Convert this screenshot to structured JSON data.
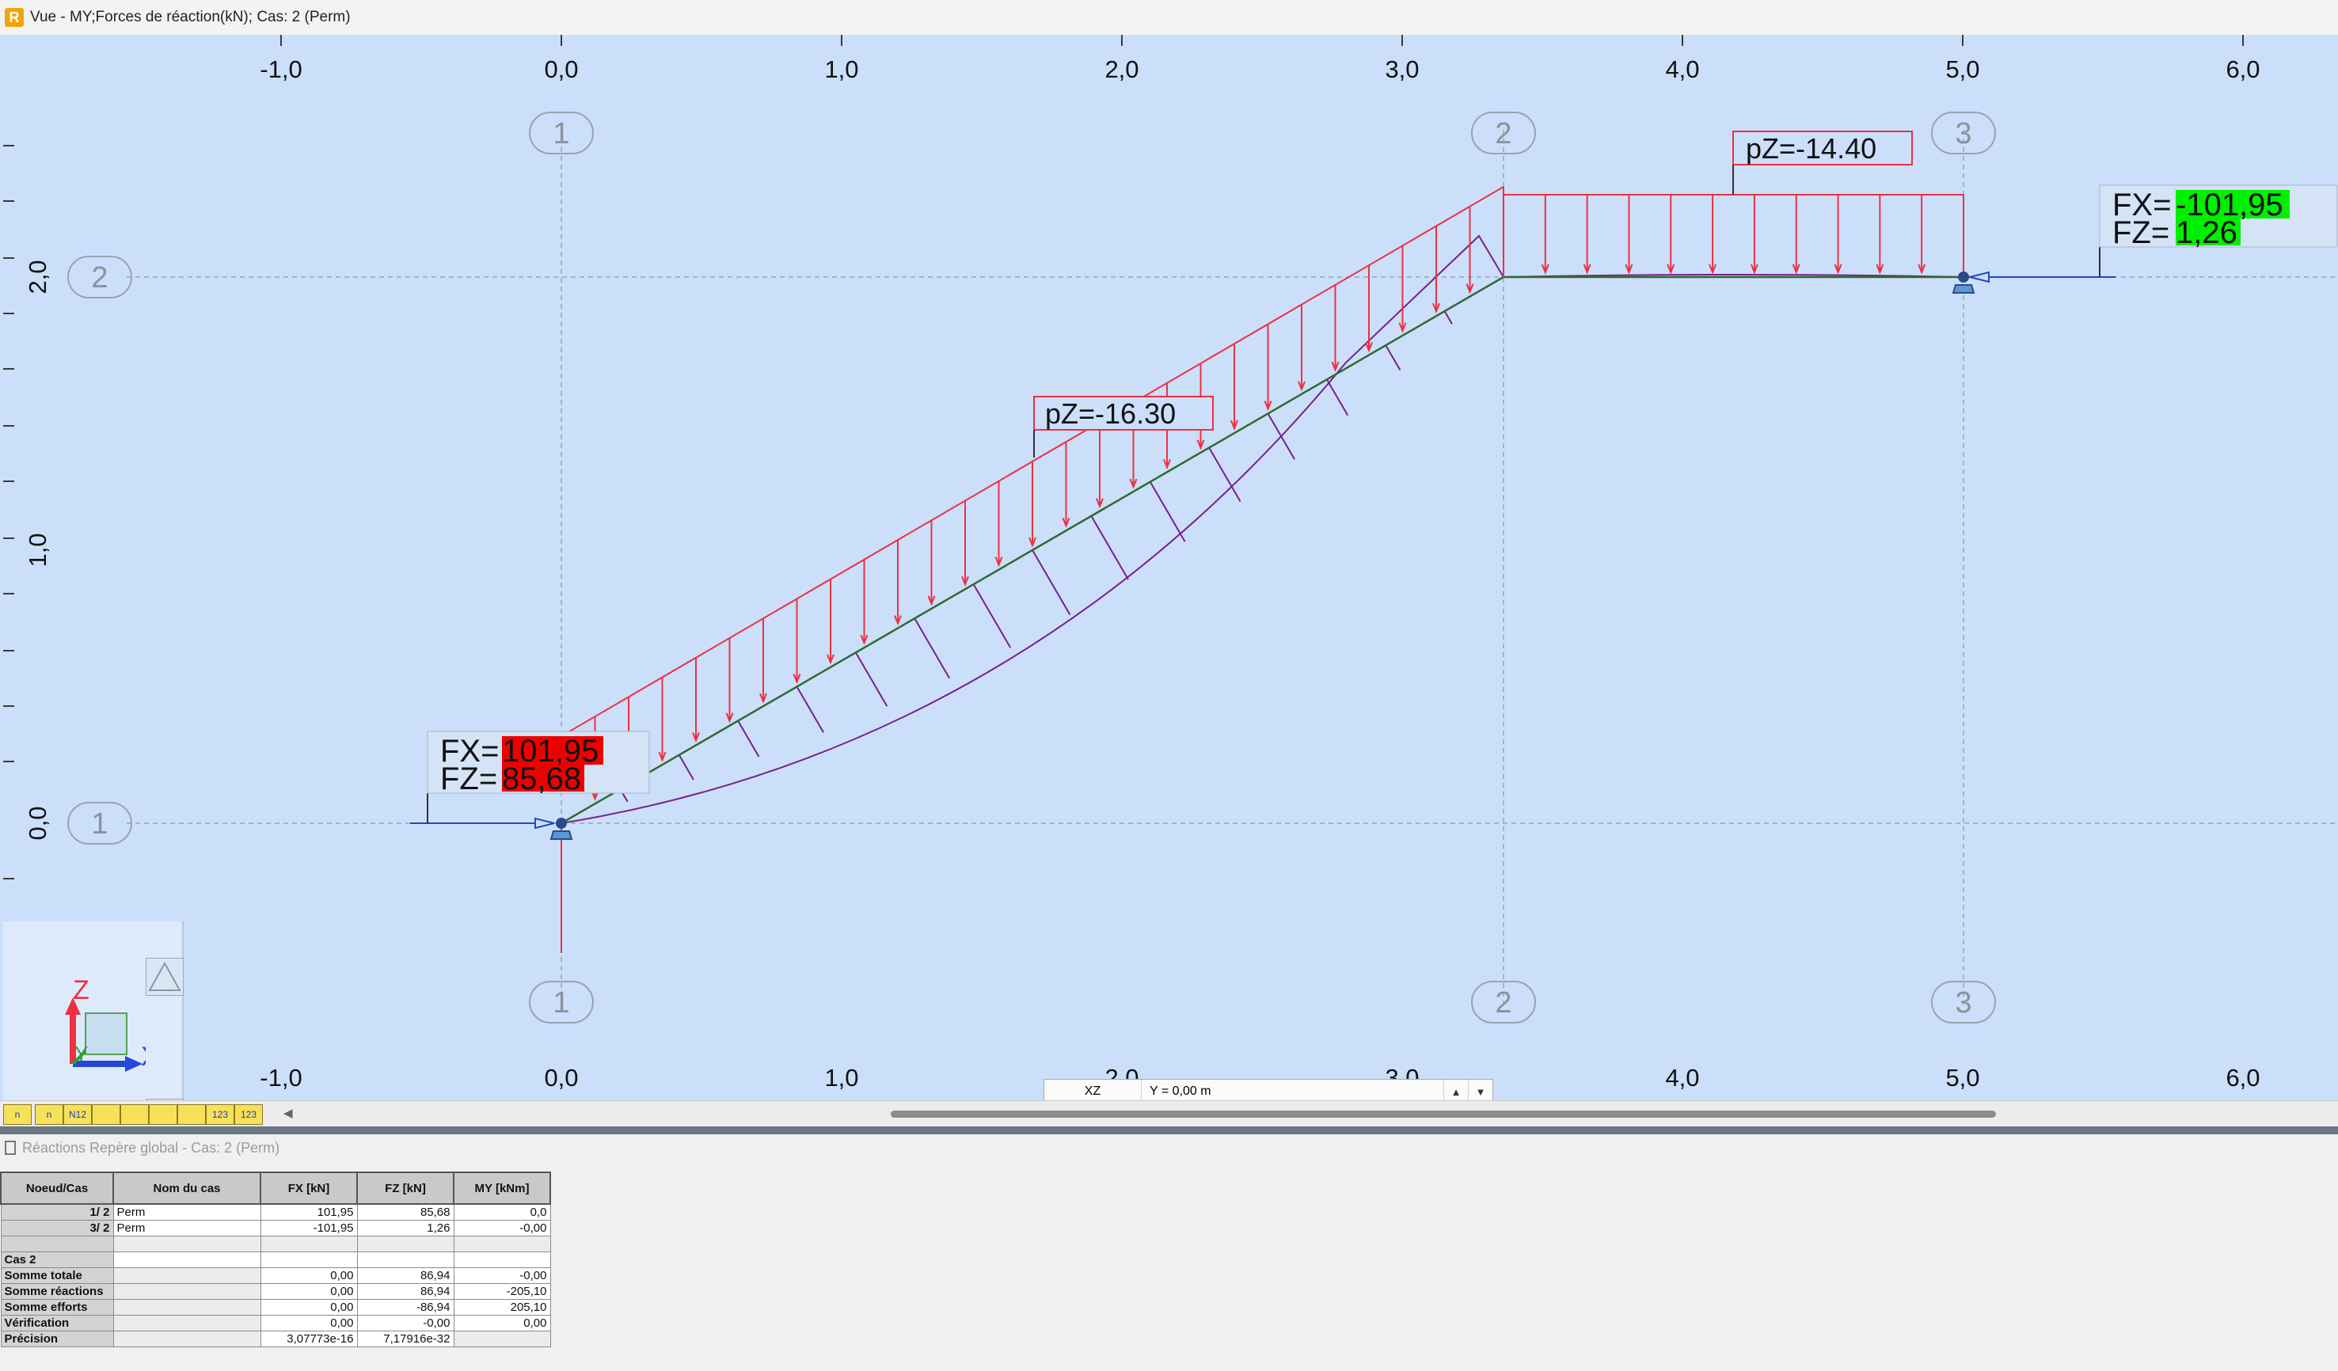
{
  "window": {
    "title": "Vue - MY;Forces de réaction(kN); Cas: 2 (Perm)",
    "icon": "app-logo-icon"
  },
  "view": {
    "x_ticks": [
      "-1,0",
      "0,0",
      "1,0",
      "2,0",
      "3,0",
      "4,0",
      "5,0",
      "6,0"
    ],
    "y_ticks": [
      "0,0",
      "1,0",
      "2,0"
    ],
    "grid_x_labels": [
      "1",
      "2",
      "3"
    ],
    "grid_y_labels": [
      "1",
      "2"
    ],
    "loads": [
      {
        "label": "pZ=-16.30"
      },
      {
        "label": "pZ=-14.40"
      }
    ],
    "reactions": [
      {
        "fx_label": "FX=",
        "fx_value": "101,95",
        "fz_label": "FZ=",
        "fz_value": "85,68",
        "color": "#ee0000"
      },
      {
        "fx_label": "FX=",
        "fx_value": "-101,95",
        "fz_label": "FZ=",
        "fz_value": "1,26",
        "color": "#00ee00"
      }
    ],
    "axes_widget": {
      "z": "Z",
      "y": "Y",
      "x": "X"
    },
    "plane": "XZ",
    "coordinate": "Y = 0,00 m",
    "colors": {
      "background": "#cbdffb",
      "load": "#ee3040",
      "moment": "#7a1f8e",
      "member": "#2e6b2e"
    }
  },
  "toolbar": {
    "items": [
      "n",
      "n",
      "N12",
      "",
      "",
      "",
      "",
      "123"
    ]
  },
  "table": {
    "title": "Réactions Repère global - Cas: 2 (Perm)",
    "headers": [
      "Noeud/Cas",
      "Nom du cas",
      "FX [kN]",
      "FZ [kN]",
      "MY [kNm]"
    ],
    "rows": [
      {
        "node": "1/      2",
        "name": "Perm",
        "fx": "101,95",
        "fz": "85,68",
        "my": "0,0"
      },
      {
        "node": "3/      2",
        "name": "Perm",
        "fx": "-101,95",
        "fz": "1,26",
        "my": "-0,00"
      }
    ],
    "case_label": "Cas 2",
    "summary": [
      {
        "label": "Somme totale",
        "fx": "0,00",
        "fz": "86,94",
        "my": "-0,00"
      },
      {
        "label": "Somme réactions",
        "fx": "0,00",
        "fz": "86,94",
        "my": "-205,10"
      },
      {
        "label": "Somme efforts",
        "fx": "0,00",
        "fz": "-86,94",
        "my": "205,10"
      },
      {
        "label": "Vérification",
        "fx": "0,00",
        "fz": "-0,00",
        "my": "0,00"
      },
      {
        "label": "Précision",
        "fx": "3,07773e-16",
        "fz": "7,17916e-32",
        "my": ""
      }
    ]
  }
}
